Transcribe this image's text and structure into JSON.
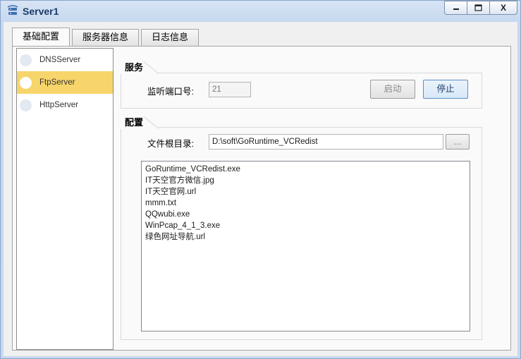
{
  "window": {
    "title": "Server1",
    "buttons": {
      "minimize": "—",
      "maximize": "□",
      "close": "X"
    }
  },
  "tabs": [
    {
      "label": "基础配置",
      "active": true
    },
    {
      "label": "服务器信息",
      "active": false
    },
    {
      "label": "日志信息",
      "active": false
    }
  ],
  "servers": [
    {
      "label": "DNSServer",
      "selected": false
    },
    {
      "label": "FtpServer",
      "selected": true
    },
    {
      "label": "HttpServer",
      "selected": false
    }
  ],
  "service": {
    "title": "服务",
    "port_label": "监听端口号:",
    "port_value": "21",
    "start_label": "启动",
    "stop_label": "停止"
  },
  "config": {
    "title": "配置",
    "root_label": "文件根目录:",
    "root_value": "D:\\soft\\GoRuntime_VCRedist",
    "browse_label": "...",
    "files": [
      "GoRuntime_VCRedist.exe",
      "IT天空官方微信.jpg",
      "IT天空官网.url",
      "mmm.txt",
      "QQwubi.exe",
      "WinPcap_4_1_3.exe",
      "绿色网址导航.url"
    ]
  },
  "colors": {
    "selected_item": "#f7d56a",
    "title_text": "#1c3a66",
    "window_frame": "#c9daf0"
  }
}
